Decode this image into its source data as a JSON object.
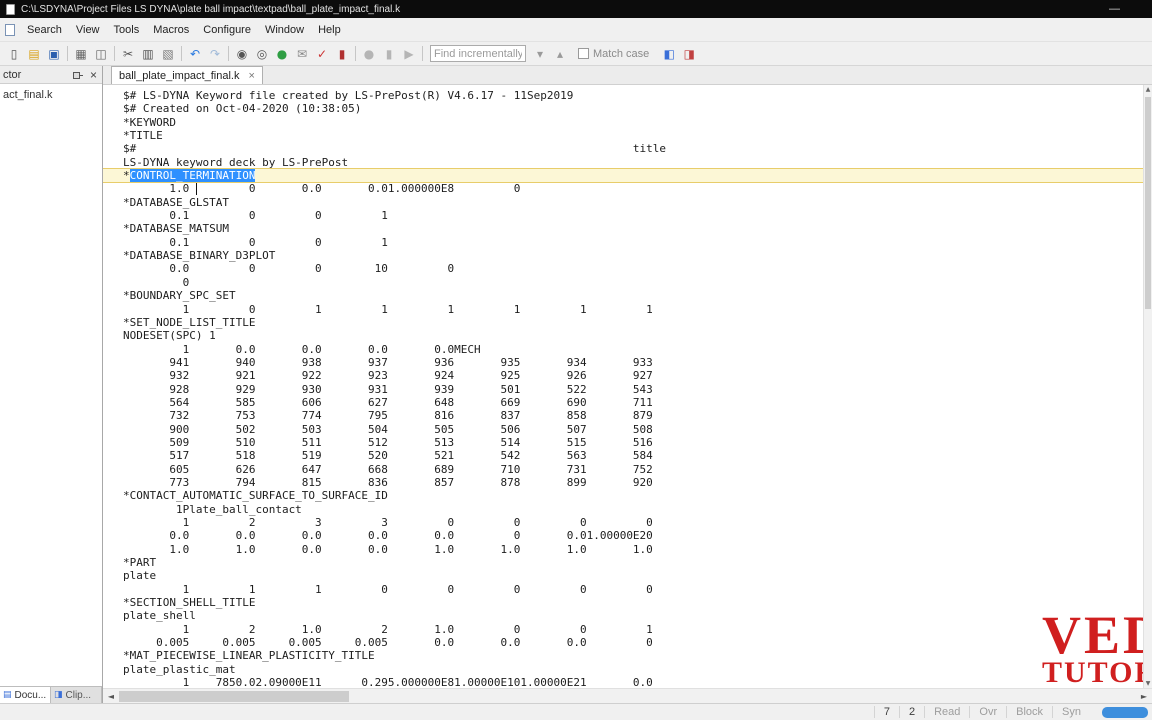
{
  "window": {
    "title": "C:\\LSDYNA\\Project Files LS DYNA\\plate ball impact\\textpad\\ball_plate_impact_final.k",
    "minimize_glyph": "—"
  },
  "menu": {
    "items": [
      "Search",
      "View",
      "Tools",
      "Macros",
      "Configure",
      "Window",
      "Help"
    ]
  },
  "toolbar": {
    "icons_left": [
      {
        "name": "new-document-icon",
        "glyph": "▯",
        "color": "#555555"
      },
      {
        "name": "open-folder-icon",
        "glyph": "▤",
        "color": "#d9a21b"
      },
      {
        "name": "save-icon",
        "glyph": "▣",
        "color": "#2b5fae"
      },
      {
        "sep": true
      },
      {
        "name": "print-icon",
        "glyph": "▦",
        "color": "#666666"
      },
      {
        "name": "print-preview-icon",
        "glyph": "◫",
        "color": "#666666"
      },
      {
        "sep": true
      },
      {
        "name": "cut-icon",
        "glyph": "✂",
        "color": "#555555"
      },
      {
        "name": "copy-icon",
        "glyph": "▥",
        "color": "#555555"
      },
      {
        "name": "paste-icon",
        "glyph": "▧",
        "color": "#777777"
      },
      {
        "sep": true
      },
      {
        "name": "undo-icon",
        "glyph": "↶",
        "color": "#2a7ae0"
      },
      {
        "name": "redo-icon",
        "glyph": "↷",
        "color": "#9fb9d8"
      },
      {
        "sep": true
      },
      {
        "name": "find-icon",
        "glyph": "◉",
        "color": "#555555"
      },
      {
        "name": "replace-icon",
        "glyph": "◎",
        "color": "#555555"
      },
      {
        "name": "browse-web-icon",
        "glyph": "●",
        "color": "#2f9e44"
      },
      {
        "name": "mail-icon",
        "glyph": "✉",
        "color": "#888888"
      },
      {
        "name": "spell-check-icon",
        "glyph": "✓",
        "color": "#cc3333"
      },
      {
        "name": "dictionary-icon",
        "glyph": "▮",
        "color": "#b03030"
      },
      {
        "sep": true
      },
      {
        "name": "macro-record-icon",
        "glyph": "●",
        "color": "#b5b5b5"
      },
      {
        "name": "macro-pause-icon",
        "glyph": "▮",
        "color": "#b5b5b5"
      },
      {
        "name": "macro-play-icon",
        "glyph": "▶",
        "color": "#b5b5b5"
      },
      {
        "sep": true
      }
    ],
    "find_placeholder": "Find incrementally",
    "find_buttons": [
      {
        "name": "find-down-icon",
        "glyph": "▾",
        "color": "#9a9a9a"
      },
      {
        "name": "find-up-icon",
        "glyph": "▴",
        "color": "#9a9a9a"
      }
    ],
    "match_case_label": "Match case",
    "icons_right": [
      {
        "name": "document-selector-icon",
        "glyph": "◧",
        "color": "#3a6fd8"
      },
      {
        "name": "clip-library-icon",
        "glyph": "◨",
        "color": "#c04040"
      }
    ]
  },
  "sidebar": {
    "header_text": "ctor",
    "close_glyph": "×",
    "items": [
      "act_final.k"
    ],
    "bottom_tabs": [
      {
        "label": "Docu...",
        "icon_name": "document-selector-tab-icon",
        "glyph": "▤",
        "color": "#3a6fd8"
      },
      {
        "label": "Clip...",
        "icon_name": "clip-library-tab-icon",
        "glyph": "◨",
        "color": "#3a6fd8"
      }
    ]
  },
  "tabs": [
    {
      "label": "ball_plate_impact_final.k",
      "close_glyph": "×"
    }
  ],
  "editor": {
    "lines": [
      "$# LS-DYNA Keyword file created by LS-PrePost(R) V4.6.17 - 11Sep2019",
      "$# Created on Oct-04-2020 (10:38:05)",
      "*KEYWORD",
      "*TITLE",
      "$#                                                                           title",
      "LS-DYNA keyword deck by LS-PrePost",
      "*CONTROL_TERMINATION",
      "       1.0         0       0.0       0.01.000000E8         0",
      "*DATABASE_GLSTAT",
      "       0.1         0         0         1",
      "*DATABASE_MATSUM",
      "       0.1         0         0         1",
      "*DATABASE_BINARY_D3PLOT",
      "       0.0         0         0        10         0",
      "         0",
      "*BOUNDARY_SPC_SET",
      "         1         0         1         1         1         1         1         1",
      "*SET_NODE_LIST_TITLE",
      "NODESET(SPC) 1",
      "         1       0.0       0.0       0.0       0.0MECH",
      "       941       940       938       937       936       935       934       933",
      "       932       921       922       923       924       925       926       927",
      "       928       929       930       931       939       501       522       543",
      "       564       585       606       627       648       669       690       711",
      "       732       753       774       795       816       837       858       879",
      "       900       502       503       504       505       506       507       508",
      "       509       510       511       512       513       514       515       516",
      "       517       518       519       520       521       542       563       584",
      "       605       626       647       668       689       710       731       752",
      "       773       794       815       836       857       878       899       920",
      "*CONTACT_AUTOMATIC_SURFACE_TO_SURFACE_ID",
      "        1Plate_ball_contact",
      "         1         2         3         3         0         0         0         0",
      "       0.0       0.0       0.0       0.0       0.0         0       0.01.00000E20",
      "       1.0       1.0       0.0       0.0       1.0       1.0       1.0       1.0",
      "*PART",
      "plate",
      "         1         1         1         0         0         0         0         0",
      "*SECTION_SHELL_TITLE",
      "plate_shell",
      "         1         2       1.0         2       1.0         0         0         1",
      "     0.005     0.005     0.005     0.005       0.0       0.0       0.0         0",
      "*MAT_PIECEWISE_LINEAR_PLASTICITY_TITLE",
      "plate_plastic_mat",
      "         1    7850.02.09000E11      0.295.000000E81.00000E101.00000E21       0.0"
    ],
    "selection": {
      "line_index": 6,
      "start": 1,
      "end": 20,
      "selected_text": "CONTROL_TERMINATION",
      "color": "#2e90ff"
    },
    "current_line_color": "#fcf7d6",
    "caret": {
      "line": 8,
      "col": 11
    },
    "scrollbar": {
      "up": "▲",
      "down": "▼",
      "left": "◄",
      "right": "►"
    }
  },
  "watermark": {
    "line1": "VED",
    "line2": "TUTOR",
    "color": "#d01f1f"
  },
  "statusbar": {
    "items": [
      {
        "label": "7",
        "dim": false
      },
      {
        "label": "2",
        "dim": false
      },
      {
        "label": "Read",
        "dim": true
      },
      {
        "label": "Ovr",
        "dim": true
      },
      {
        "label": "Block",
        "dim": true
      },
      {
        "label": "Syn",
        "dim": true
      }
    ],
    "thumb_color": "#3e8fdd"
  }
}
